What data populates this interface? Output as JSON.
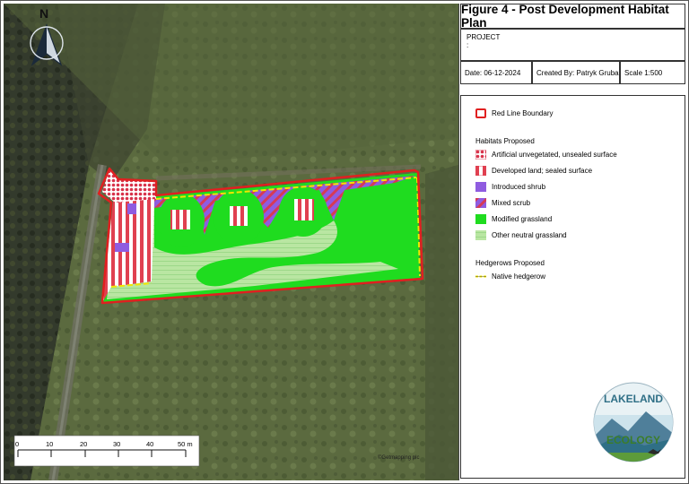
{
  "title": "Figure 4 - Post Development Habitat Plan",
  "project_label": "PROJECT",
  "project_value": ":",
  "date": "Date: 06-12-2024",
  "created_by": "Created By: Patryk Gruba",
  "scale": "Scale 1:500",
  "north_label": "N",
  "copyright": "©Getmapping plc",
  "scale_bar": {
    "ticks": [
      "0",
      "10",
      "20",
      "30",
      "40",
      "50 m"
    ]
  },
  "legend": {
    "boundary": "Red Line Boundary",
    "habitats_heading": "Habitats Proposed",
    "habitats": [
      "Artificial unvegetated, unsealed surface",
      "Developed land; sealed surface",
      "Introduced shrub",
      "Mixed scrub",
      "Modified grassland",
      "Other neutral grassland"
    ],
    "hedgerows_heading": "Hedgerows Proposed",
    "hedgerows": [
      "Native hedgerow"
    ]
  },
  "logo": {
    "top_text": "LAKELAND",
    "bottom_text": "ECOLOGY"
  },
  "colors": {
    "boundary": "#e02020",
    "developed": "#e04050",
    "introduced_shrub": "#8f5ce0",
    "modified_grassland": "#1fdc1f",
    "neutral_grassland": "#b9e6a2",
    "hedgerow": "#f2e600"
  }
}
